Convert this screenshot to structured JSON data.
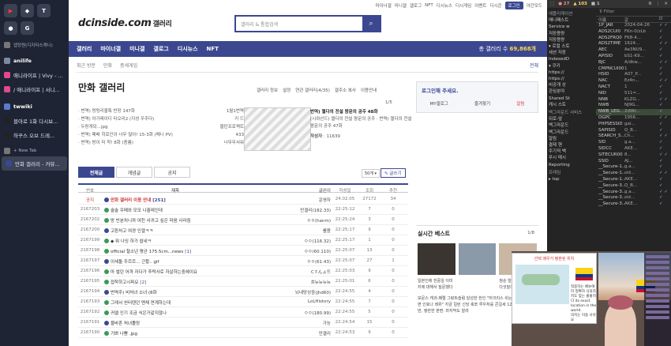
{
  "tabs": {
    "pinned": [
      {
        "icon": "youtube-icon",
        "glyph": "▶"
      },
      {
        "icon": "discord-icon",
        "glyph": "◆"
      },
      {
        "icon": "t-app-icon",
        "glyph": "T"
      },
      {
        "icon": "chrome-icon",
        "glyph": "●"
      },
      {
        "icon": "google-icon",
        "glyph": "G"
      }
    ],
    "items": [
      {
        "label": "앱정원(디지타스캐니)",
        "kind": "small",
        "icon": "globe-icon",
        "color": "#777"
      },
      {
        "label": "anilife",
        "kind": "grp",
        "icon": "folder-icon",
        "color": "#7b8aa0"
      },
      {
        "label": "애니라이프 | Vivy - ...",
        "kind": "tab",
        "icon": "anilife-icon",
        "color": "#e04a8a"
      },
      {
        "label": "/ 애니라이프 | 서니...",
        "kind": "tab",
        "icon": "anilife-icon",
        "color": "#e04a8a"
      },
      {
        "label": "twwiki",
        "kind": "grp",
        "icon": "folder-icon",
        "color": "#5a7ad0"
      },
      {
        "label": "블아로 1화 다시보...",
        "kind": "tab",
        "icon": "t-app-icon",
        "color": "#222"
      },
      {
        "label": "하꾸스 오브 드레...",
        "kind": "tab",
        "icon": "t-app-icon",
        "color": "#222"
      },
      {
        "label": "+ New Tab",
        "kind": "small",
        "icon": "plus-icon",
        "color": "#777"
      },
      {
        "label": "만화 갤러리 - 커뮤...",
        "kind": "active",
        "icon": "dc-icon",
        "color": "#3b4890"
      }
    ]
  },
  "site": {
    "topbar": [
      "마이너갤",
      "미니갤",
      "갤로그",
      "NFT",
      "디시뉴스",
      "디시게임",
      "이벤트",
      "디시콘"
    ],
    "login_chip": "로그인",
    "darkmode": "야간모드",
    "logo": "dcinside.com",
    "logo_sub": "갤러리",
    "search_placeholder": "갤러리 & 통합검색",
    "gnb": [
      "갤러리",
      "마이너갤",
      "미니갤",
      "갤로그",
      "디시뉴스",
      "NFT"
    ],
    "gnb_count_label": "총 갤러리 수",
    "gnb_count": "69,868개",
    "crumb": [
      "최근 방문",
      "만화",
      "종세게임"
    ],
    "crumb_all": "전체",
    "title": "만화 갤러리",
    "gmenu": [
      "갤러리 정보",
      "설정",
      "연관 갤러리(4/35)",
      "갤주소 복사",
      "이용안내"
    ],
    "rank": [
      {
        "t": "· 번역) 멍텅리울톡 반장 147화",
        "v": "1월1번역"
      },
      {
        "t": "· 번역) 아가레이디 타오리2 (지성 우주다)",
        "v": "키 드"
      },
      {
        "t": "· 두랑게되...jpg",
        "v": "물탄프로젝트"
      },
      {
        "t": "· 번역) 패배 히로인이 너무 많아! 15-3화 (메니 PV)",
        "v": "433"
      },
      {
        "t": "· 번역) 방이 미 착! 8화 (종룡)",
        "v": "너무무서워"
      }
    ],
    "feat_title": "번역) 젤다의 전설 왕문의 공주 48화",
    "feat_body": "(시와선드) 젤다의 전설 왕문의 공주 · 번역) 젤다의 전설 왕문의 공주 47화",
    "feat_author_label": "작성자",
    "feat_author": "11639",
    "feat_page": "1/5",
    "login_title": "로그인해 주세요.",
    "login_links": [
      "MY갤로그",
      "즐겨찾기",
      "알림"
    ],
    "board_tabs": [
      "전체글",
      "개념글",
      "공지"
    ],
    "sort_value": "50개",
    "write_label": "글쓰기",
    "columns": [
      "번호",
      "제목",
      "글쓴이",
      "작성일",
      "조회",
      "추천"
    ],
    "rows": [
      {
        "no": "공지",
        "title": "만화 갤러리 이용 안내",
        "tag": "[251]",
        "writer": "운영자",
        "date": "24.02.05",
        "views": "27172",
        "rec": "34",
        "notice": true
      },
      {
        "no": "2167203",
        "title": "술술 우메와 모모 나홀레인데",
        "tag": "",
        "writer": "만결리(182.33)",
        "date": "22:25:12",
        "views": "7",
        "rec": "0"
      },
      {
        "no": "2167202",
        "title": "방 빈분치니까 여친 사귀고 싶은 마음 사라짐",
        "tag": "",
        "writer": "ㅇㅇ(hanm)",
        "date": "22:25:24",
        "views": "3",
        "rec": "0"
      },
      {
        "no": "2167200",
        "title": "고환처고 여경 인겔ㅋㅋ",
        "tag": "",
        "writer": "를뭄",
        "date": "22:25:17",
        "views": "9",
        "rec": "0"
      },
      {
        "no": "2167199",
        "title": "◆ 뭐 나잉 하가 쉽네ㅋ",
        "tag": "",
        "writer": "ㅇㅇ(116.32)",
        "date": "22:25:17",
        "views": "1",
        "rec": "0"
      },
      {
        "no": "2167198",
        "title": "official 철소년 평균 175.5cm...news",
        "tag": "[1]",
        "writer": "ㅇㅇ(60.110)",
        "date": "22:25:07",
        "views": "13",
        "rec": "0"
      },
      {
        "no": "2167197",
        "title": "이세돌 주르르... 근황.. gif",
        "tag": "",
        "writer": "ㅇㅇ(61.43)",
        "date": "22:25:07",
        "views": "27",
        "rec": "1"
      },
      {
        "no": "2167196",
        "title": "마 벌던 어까 자다가 추락사로 자살하는중헤이요",
        "tag": "",
        "writer": "Cㅎんょ뜨",
        "date": "22:25:03",
        "views": "9",
        "rec": "0"
      },
      {
        "no": "2167195",
        "title": "접착하고시퍼요",
        "tag": "[2]",
        "writer": "흐뉴뉴뉴뉴",
        "date": "22:25:01",
        "views": "6",
        "rec": "0"
      },
      {
        "no": "2167194",
        "title": "번역주) 비처녀 소녀 (8화",
        "tag": "",
        "writer": "뇌내망상중(jhd60)",
        "date": "22:24:55",
        "views": "4",
        "rec": "0"
      },
      {
        "no": "2167193",
        "title": "그레서 씬터텐던 멘체 연계하는데",
        "tag": "",
        "writer": "LoLHistory",
        "date": "22:24:55",
        "views": "7",
        "rec": "0"
      },
      {
        "no": "2167192",
        "title": "귀엘 인기 조금 식은거같지않나",
        "tag": "",
        "writer": "ㅇㅇ(180.99)",
        "date": "22:24:55",
        "views": "5",
        "rec": "0"
      },
      {
        "no": "2167191",
        "title": "블바흔 처녀졸망",
        "tag": "",
        "writer": "가능",
        "date": "22:24:54",
        "views": "15",
        "rec": "0"
      },
      {
        "no": "2167190",
        "title": "기쁘 나쁨 .jpg",
        "tag": "",
        "writer": "만결리",
        "date": "22:24:53",
        "views": "9",
        "rec": "0"
      }
    ],
    "best_title": "실시간 베스트",
    "best_page": "1/8",
    "best_items": [
      "일본인에 한중일 이미지에 대해서 질문했다",
      "",
      "청순 얼굴의 다선 쥐의 다섯질이 덧붙은"
    ],
    "best_long": "모문스 캐과-페렐 그랑트슬럼 달성한 한인 \"머크리스 쉬는날 터미 돈 보면 인호나 레위\" 지금 킬런 신당 축쪼 루우처를 콘걸세 12세 동 벌로 10번, 앵한한 판편. 마지막도 알려"
  },
  "devtools": {
    "counts": {
      "errors": "27",
      "warnings": "103",
      "issues": "1"
    },
    "filter": "Filter",
    "tree": [
      "애플리케이션",
      "매니페스트",
      "Service w",
      "저장용량",
      "저장용량",
      "▾ 로컬 스토",
      "세션 저장",
      "IndexedD",
      "▾ 쿠키",
      "https://",
      "https://",
      "비공개 상",
      "관심분야",
      "Shared St",
      "캐시 스토",
      "",
      "백그라운드 서비스",
      "뒤로-앞",
      "백그라운드",
      "백그라운드",
      "알림",
      "결제 핸",
      "주기적 백",
      "푸시 메시",
      "Reporting",
      "",
      "프레임",
      "▸ top"
    ],
    "headers": [
      "이름",
      "값",
      "D"
    ],
    "rows": [
      {
        "n": "1P_JAR",
        "v": "2024-04-26"
      },
      {
        "n": "ADS2CUI0",
        "v": "FKn-0/zLb"
      },
      {
        "n": "ADS2FRQ0",
        "v": "FK8-4..."
      },
      {
        "n": "ADS2TIME",
        "v": "1624..."
      },
      {
        "n": "AEC",
        "v": "Ae3NU9..."
      },
      {
        "n": "APISID",
        "v": "bS1-K9..."
      },
      {
        "n": "BJC",
        "v": "A/dkw..."
      },
      {
        "n": "CMPNCUI00",
        "v": "1"
      },
      {
        "n": "HSID",
        "v": "A07_P..."
      },
      {
        "n": "NAC",
        "v": "Ez4n..."
      },
      {
        "n": "NACT",
        "v": "1"
      },
      {
        "n": "NID",
        "v": "511=..."
      },
      {
        "n": "NNB",
        "v": "KLZG..."
      },
      {
        "n": "NWB",
        "v": "NJ9G..."
      },
      {
        "n": "NWB_LEG...",
        "v": "2dWc..."
      },
      {
        "n": "OGPC",
        "v": "1956..."
      },
      {
        "n": "PHPSESSID",
        "v": "gal..."
      },
      {
        "n": "SAPISID",
        "v": "Q_B..."
      },
      {
        "n": "SEARCH_S...",
        "v": "Ch..."
      },
      {
        "n": "SID",
        "v": "g.a..."
      },
      {
        "n": "SIDCC",
        "v": "AKE..."
      },
      {
        "n": "SITECUR00",
        "v": "8..."
      },
      {
        "n": "SSID",
        "v": "AJ..."
      },
      {
        "n": "__Secure-1...",
        "v": "g.a..."
      },
      {
        "n": "__Secure-1...",
        "v": "sid..."
      },
      {
        "n": "__Secure-1...",
        "v": "AKE..."
      },
      {
        "n": "__Secure-3...",
        "v": "Q_B..."
      },
      {
        "n": "__Secure-3...",
        "v": "g.a..."
      },
      {
        "n": "__Secure-3...",
        "v": "sid..."
      },
      {
        "n": "__Secure-3...",
        "v": "AKE..."
      }
    ],
    "selected_row": 14
  },
  "stream": {
    "popup_title": "선택 매우가 평판된 위치",
    "popup_text": "적중하는 베뉴에라 정확하 식의하지도 맞는 출출히다 its exact location in the world.",
    "popup_sub": "의치는 이용 사유요"
  }
}
